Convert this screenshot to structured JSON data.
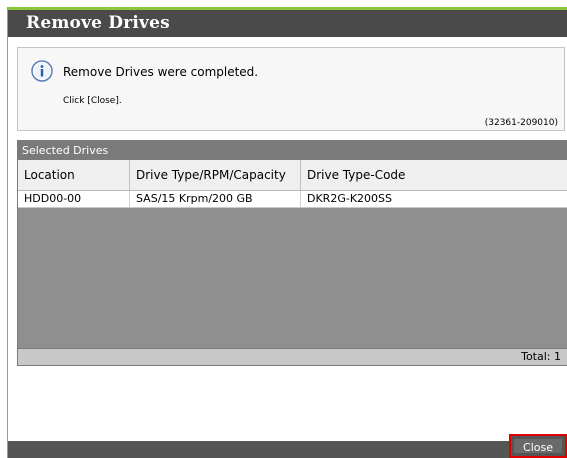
{
  "dialog": {
    "title": "Remove Drives"
  },
  "message": {
    "icon": "info-icon",
    "text": "Remove Drives were completed.",
    "instruction": "Click [Close].",
    "code": "(32361-209010)"
  },
  "selected_drives": {
    "header": "Selected Drives",
    "columns": [
      "Location",
      "Drive Type/RPM/Capacity",
      "Drive Type-Code"
    ],
    "rows": [
      [
        "HDD00-00",
        "SAS/15 Krpm/200 GB",
        "DKR2G-K200SS"
      ]
    ],
    "total_label": "Total: 1"
  },
  "footer": {
    "close_label": "Close"
  },
  "colors": {
    "title_bar": "#4a4a4a",
    "title_accent": "#8cc63f",
    "highlight": "#e00000"
  }
}
